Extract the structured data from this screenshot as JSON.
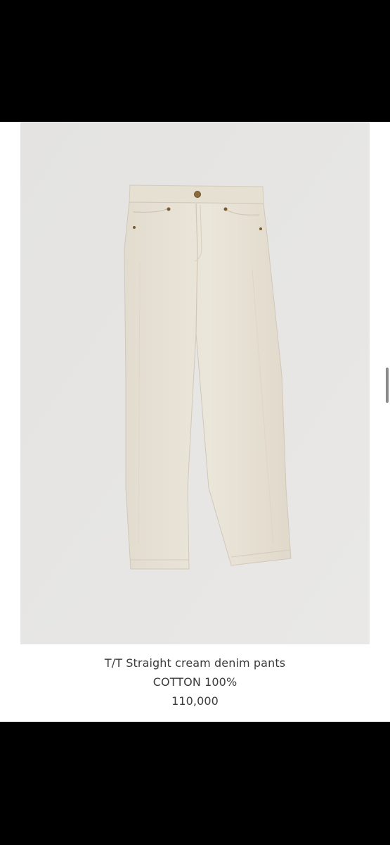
{
  "product": {
    "name": "T/T Straight cream denim pants",
    "material": "COTTON 100%",
    "price": "110,000"
  },
  "image": {
    "subject": "cream straight denim pants",
    "background_color": "#e6e5e3",
    "garment_color": "#e9e3d6"
  },
  "icons": {
    "scroll": "scroll-indicator"
  }
}
